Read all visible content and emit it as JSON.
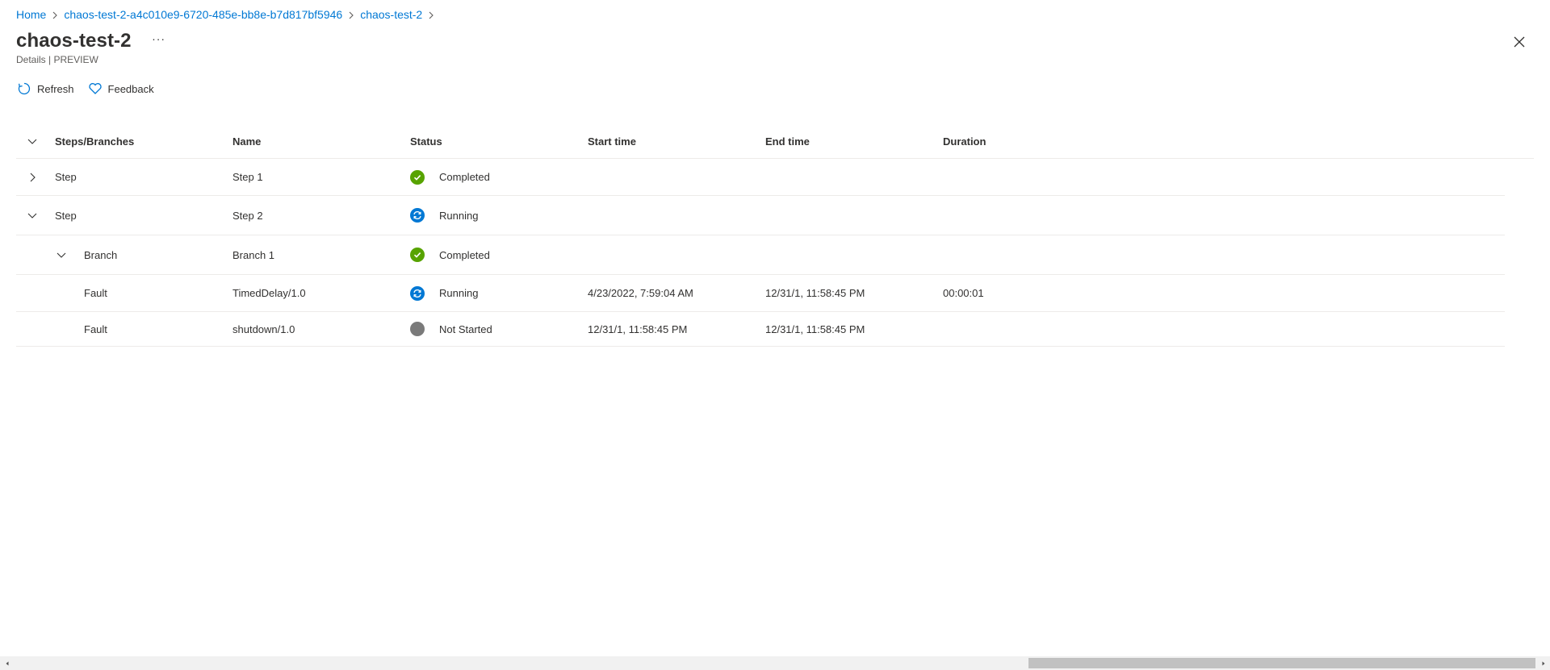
{
  "breadcrumb": {
    "items": [
      "Home",
      "chaos-test-2-a4c010e9-6720-485e-bb8e-b7d817bf5946",
      "chaos-test-2"
    ]
  },
  "header": {
    "title": "chaos-test-2",
    "more_label": "···",
    "subtitle": "Details | PREVIEW"
  },
  "toolbar": {
    "refresh_label": "Refresh",
    "feedback_label": "Feedback"
  },
  "grid": {
    "columns": [
      "Steps/Branches",
      "Name",
      "Status",
      "Start time",
      "End time",
      "Duration"
    ],
    "rows": [
      {
        "kind": "Step",
        "name": "Step 1",
        "status": "Completed",
        "start": "",
        "end": "",
        "duration": ""
      },
      {
        "kind": "Step",
        "name": "Step 2",
        "status": "Running",
        "start": "",
        "end": "",
        "duration": ""
      },
      {
        "kind": "Branch",
        "name": "Branch 1",
        "status": "Completed",
        "start": "",
        "end": "",
        "duration": ""
      },
      {
        "kind": "Fault",
        "name": "TimedDelay/1.0",
        "status": "Running",
        "start": "4/23/2022, 7:59:04 AM",
        "end": "12/31/1, 11:58:45 PM",
        "duration": "00:00:01"
      },
      {
        "kind": "Fault",
        "name": "shutdown/1.0",
        "status": "Not Started",
        "start": "12/31/1, 11:58:45 PM",
        "end": "12/31/1, 11:58:45 PM",
        "duration": ""
      }
    ]
  },
  "colors": {
    "link": "#0078d4",
    "completed": "#57a300",
    "running": "#0078d4",
    "not_started": "#7a7a7a"
  },
  "icons": {
    "refresh": "refresh-icon",
    "feedback": "heart-icon",
    "close": "close-icon",
    "expand": "chevron-down-icon",
    "collapse": "chevron-right-icon"
  }
}
